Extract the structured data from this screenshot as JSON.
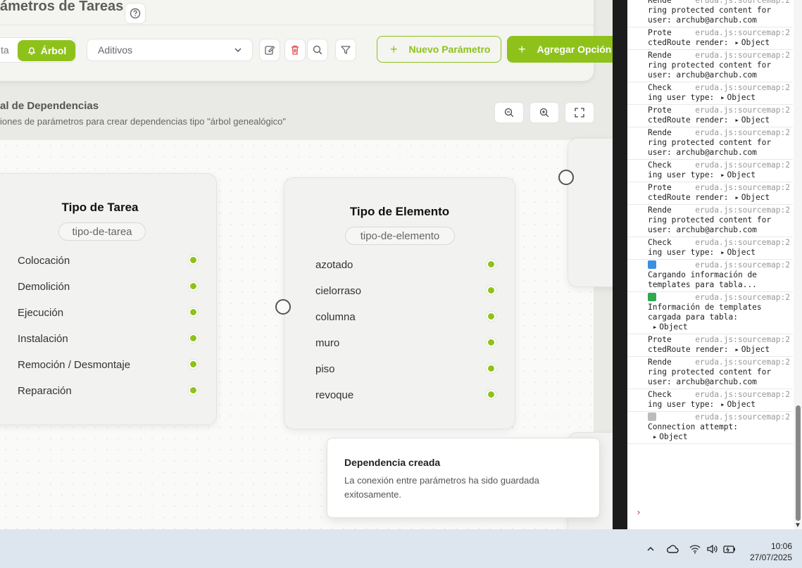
{
  "header": {
    "title": "ámetros de Tareas"
  },
  "toolbar": {
    "view_prev_label": "ta",
    "view_active_label": "Árbol",
    "select_value": "Aditivos",
    "new_param_label": "Nuevo Parámetro",
    "add_option_label": "Agregar Opción"
  },
  "section": {
    "title": "al de Dependencias",
    "subtitle": "iones de parámetros para crear dependencias tipo \"árbol genealógico\""
  },
  "nodes": [
    {
      "title": "Tipo de Tarea",
      "slug": "tipo-de-tarea",
      "options": [
        "Colocación",
        "Demolición",
        "Ejecución",
        "Instalación",
        "Remoción / Desmontaje",
        "Reparación"
      ]
    },
    {
      "title": "Tipo de Elemento",
      "slug": "tipo-de-elemento",
      "options": [
        "azotado",
        "cielorraso",
        "columna",
        "muro",
        "piso",
        "revoque"
      ]
    }
  ],
  "toast": {
    "title": "Dependencia creada",
    "message": "La conexión entre parámetros ha sido guardada exitosamente."
  },
  "console": {
    "source": "eruda.js:sourcemap:2",
    "entries": [
      {
        "kind": "cut",
        "prefix": "Rende",
        "text": "ring protected content for user: archub@archub.com"
      },
      {
        "kind": "obj",
        "prefix": "Prote",
        "text": "ctedRoute render:",
        "obj": "Object"
      },
      {
        "kind": "text",
        "prefix": "Rende",
        "text": "ring protected content for user: archub@archub.com"
      },
      {
        "kind": "obj",
        "prefix": "Check",
        "text": "ing user type:",
        "obj": "Object"
      },
      {
        "kind": "obj",
        "prefix": "Prote",
        "text": "ctedRoute render:",
        "obj": "Object"
      },
      {
        "kind": "text",
        "prefix": "Rende",
        "text": "ring protected content for user: archub@archub.com"
      },
      {
        "kind": "obj",
        "prefix": "Check",
        "text": "ing user type:",
        "obj": "Object"
      },
      {
        "kind": "obj",
        "prefix": "Prote",
        "text": "ctedRoute render:",
        "obj": "Object"
      },
      {
        "kind": "text",
        "prefix": "Rende",
        "text": "ring protected content for user: archub@archub.com"
      },
      {
        "kind": "obj",
        "prefix": "Check",
        "text": "ing user type:",
        "obj": "Object"
      },
      {
        "kind": "badge",
        "badge_color": "#3d8fe0",
        "text": "Cargando información de templates para tabla..."
      },
      {
        "kind": "badge",
        "badge_color": "#2ea94f",
        "text": "Información de templates cargada para tabla:",
        "obj": "Object"
      },
      {
        "kind": "obj",
        "prefix": "Prote",
        "text": "ctedRoute render:",
        "obj": "Object"
      },
      {
        "kind": "text",
        "prefix": "Rende",
        "text": "ring protected content for user: archub@archub.com"
      },
      {
        "kind": "obj",
        "prefix": "Check",
        "text": "ing user type:",
        "obj": "Object"
      },
      {
        "kind": "badge",
        "badge_color": "#bbbbbb",
        "text": "Connection attempt:",
        "obj": "Object"
      }
    ]
  },
  "taskbar": {
    "time": "10:06",
    "date": "27/07/2025"
  },
  "colors": {
    "accent": "#8ec21b",
    "danger": "#e04848"
  }
}
